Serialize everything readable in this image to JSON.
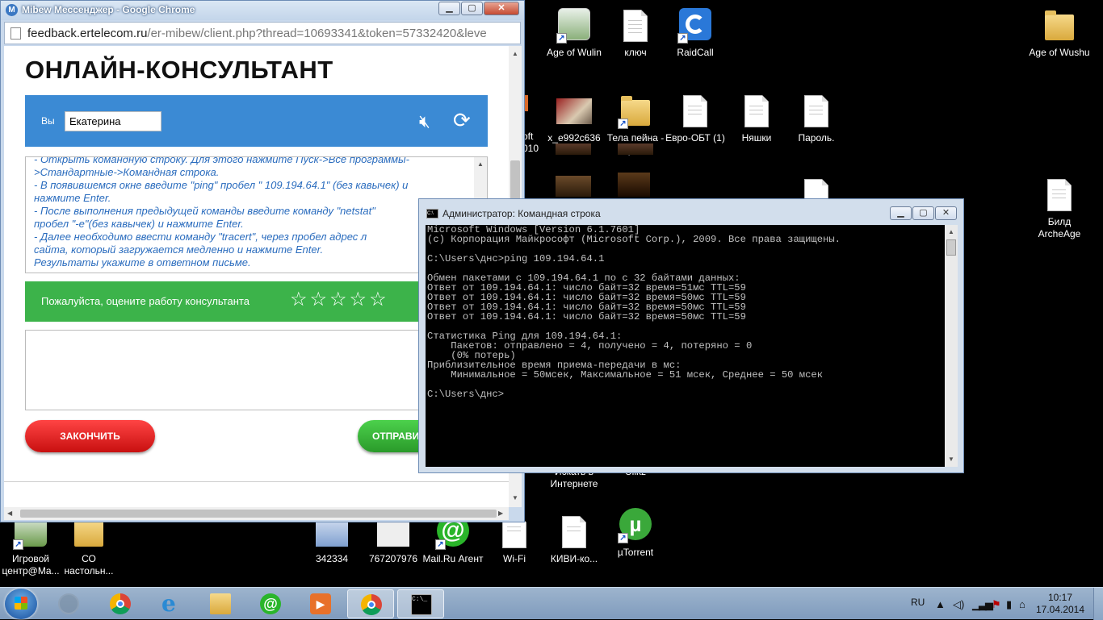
{
  "desktop": {
    "icons": [
      {
        "label": "Age of Wulin",
        "kind": "app"
      },
      {
        "label": "ключ",
        "kind": "doc"
      },
      {
        "label": "RaidCall",
        "kind": "app"
      },
      {
        "label": "Age of Wushu",
        "kind": "folder"
      },
      {
        "label": "x_e992c636",
        "kind": "photo"
      },
      {
        "label": "Тела пейна - Ярлык",
        "kind": "folder"
      },
      {
        "label": "Евро-ОБТ (1)",
        "kind": "doc"
      },
      {
        "label": "Няшки",
        "kind": "doc"
      },
      {
        "label": "Пароль.",
        "kind": "doc"
      },
      {
        "label": "Билд ArcheAge",
        "kind": "doc"
      },
      {
        "label": "Игровой центр@Ma...",
        "kind": "app"
      },
      {
        "label": "СО настольн...",
        "kind": "folder"
      },
      {
        "label": "342334",
        "kind": "image"
      },
      {
        "label": "767207976",
        "kind": "image"
      },
      {
        "label": "Mail.Ru Агент",
        "kind": "app"
      },
      {
        "label": "Wi-Fi",
        "kind": "doc"
      },
      {
        "label": "КИВИ-ко...",
        "kind": "doc"
      },
      {
        "label": "µTorrent",
        "kind": "app"
      },
      {
        "label": "Искать в Интернете",
        "kind": "app"
      }
    ],
    "partial_labels": [
      "e",
      "oft",
      "010",
      "Ulikz"
    ]
  },
  "chrome": {
    "title": "Mibew Мессенджер - Google Chrome",
    "url_host": "feedback.ertelecom.ru",
    "url_path": "/er-mibew/client.php?thread=10693341&token=57332420&leve",
    "heading": "ОНЛАЙН-КОНСУЛЬТАНТ",
    "you_label": "Вы",
    "name_value": "Екатерина",
    "chat_lines": [
      "- Открыть командную строку. Для этого нажмите Пуск->Все программы-",
      ">Стандартные->Командная строка.",
      "- В появившемся окне введите \"ping\" пробел \" 109.194.64.1\" (без кавычек) и",
      "нажмите Enter.",
      "- После выполнения предыдущей команды введите команду \"netstat\"",
      "пробел \"-e\"(без кавычек) и нажмите Enter.",
      "- Далее необходимо ввести команду \"tracert\", через пробел адрес л",
      "сайта, который загружается медленно и нажмите Enter.",
      "Результаты укажите в ответном письме."
    ],
    "rate_text": "Пожалуйста, оцените работу консультанта",
    "rating_stars": 5,
    "rating_value": 0,
    "end_button": "ЗАКОНЧИТЬ",
    "send_button": "ОТПРАВИ"
  },
  "cmd": {
    "title": "Администратор: Командная строка",
    "lines": [
      "Microsoft Windows [Version 6.1.7601]",
      "(c) Корпорация Майкрософт (Microsoft Corp.), 2009. Все права защищены.",
      "",
      "C:\\Users\\днс>ping 109.194.64.1",
      "",
      "Обмен пакетами с 109.194.64.1 по с 32 байтами данных:",
      "Ответ от 109.194.64.1: число байт=32 время=51мс TTL=59",
      "Ответ от 109.194.64.1: число байт=32 время=50мс TTL=59",
      "Ответ от 109.194.64.1: число байт=32 время=50мс TTL=59",
      "Ответ от 109.194.64.1: число байт=32 время=50мс TTL=59",
      "",
      "Статистика Ping для 109.194.64.1:",
      "    Пакетов: отправлено = 4, получено = 4, потеряно = 0",
      "    (0% потерь)",
      "Приблизительное время приема-передачи в мс:",
      "    Минимальное = 50мсек, Максимальное = 51 мсек, Среднее = 50 мсек",
      "",
      "C:\\Users\\днс>"
    ]
  },
  "taskbar": {
    "language": "RU",
    "time": "10:17",
    "date": "17.04.2014",
    "pinned": [
      "Google Chrome",
      "Internet Explorer",
      "Проводник",
      "Mail.Ru Агент",
      "Media Player",
      "Google Chrome (активно)",
      "Командная строка"
    ]
  },
  "colors": {
    "blue_bar": "#3b8ad4",
    "green_bar": "#3cb34a",
    "end_button": "#e02020",
    "send_button": "#34b534",
    "chat_text": "#2a6cbe"
  }
}
